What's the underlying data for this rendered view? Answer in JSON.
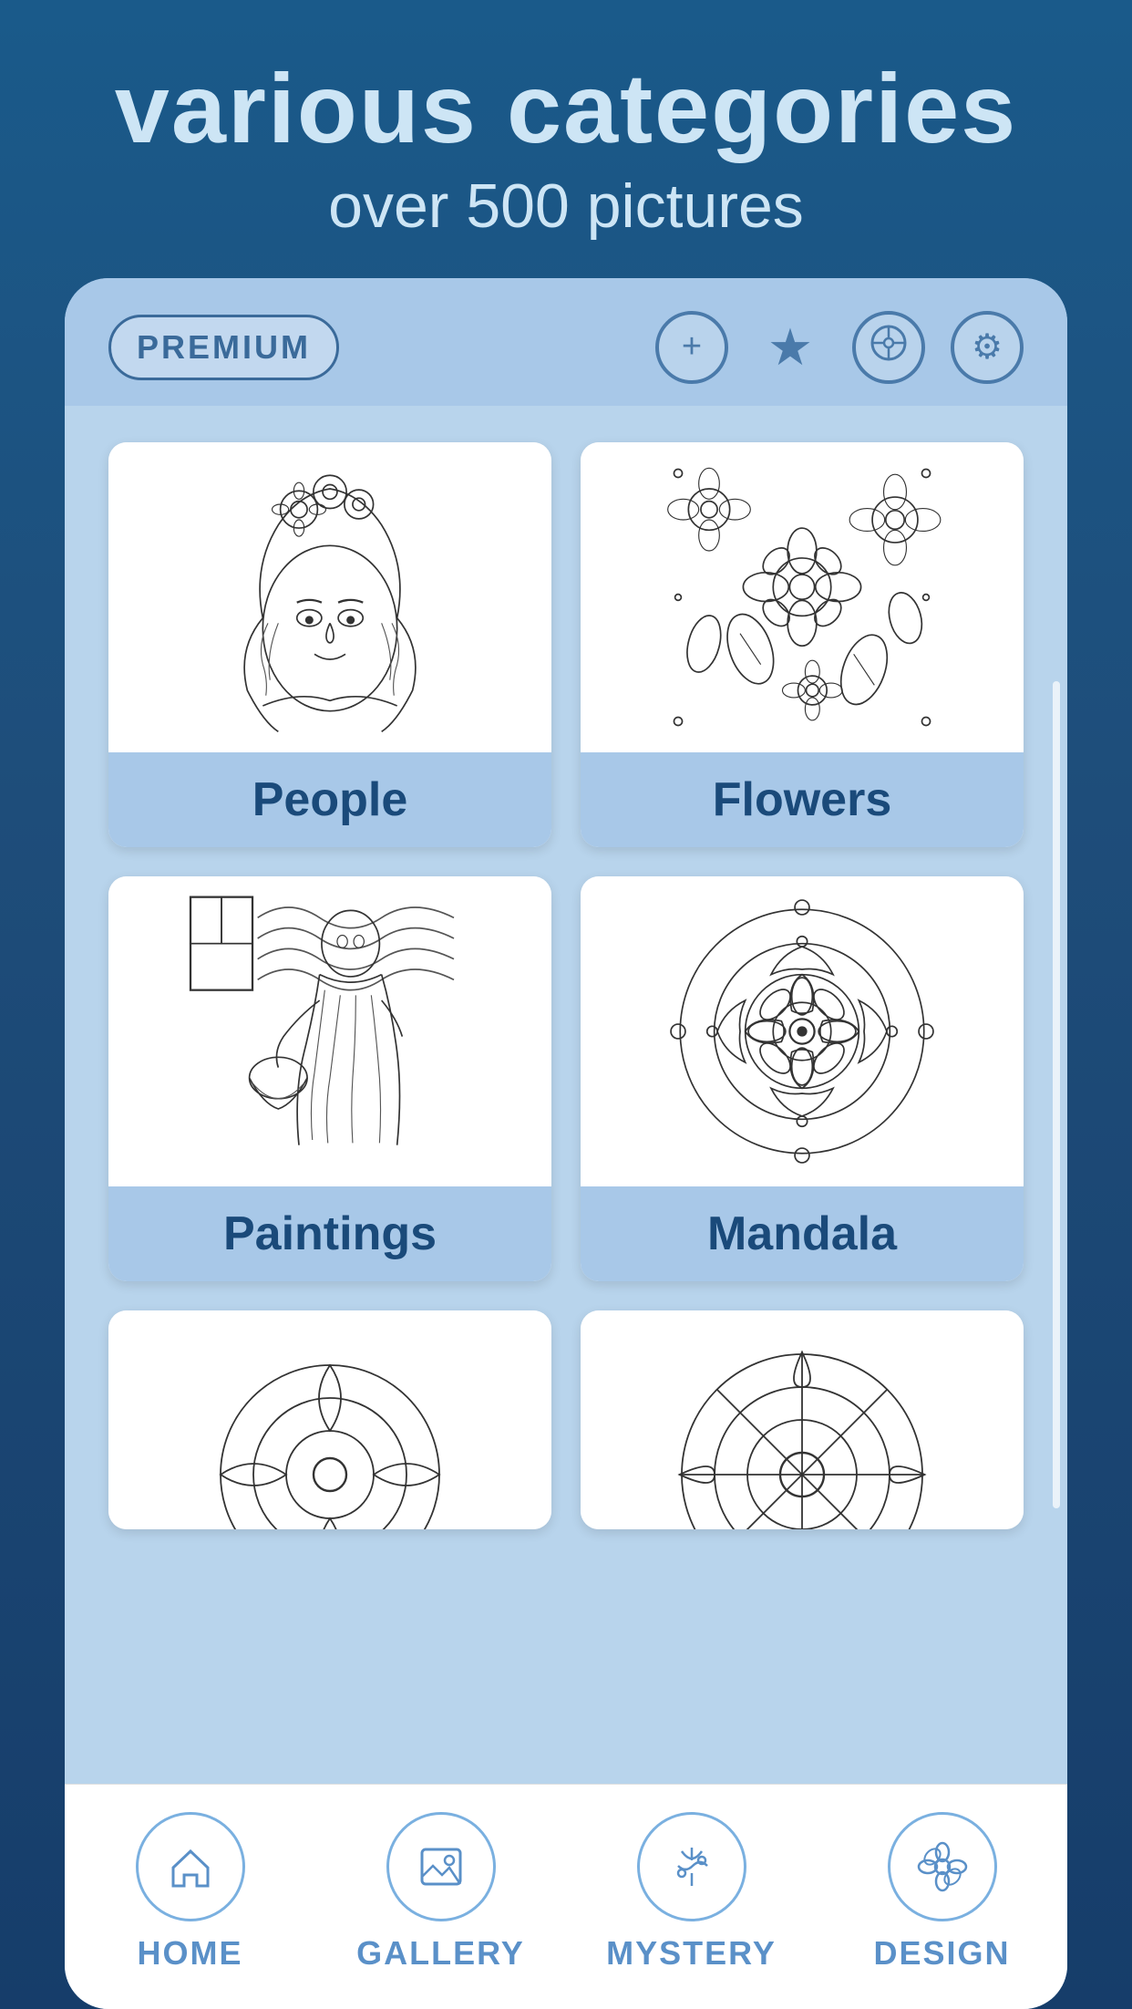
{
  "header": {
    "title": "various categories",
    "subtitle": "over 500 pictures"
  },
  "topbar": {
    "premium_label": "PREMIUM",
    "icons": [
      {
        "name": "add-icon",
        "symbol": "+"
      },
      {
        "name": "star-icon",
        "symbol": "★"
      },
      {
        "name": "share-icon",
        "symbol": "⊙"
      },
      {
        "name": "settings-icon",
        "symbol": "⚙"
      }
    ]
  },
  "categories": [
    {
      "id": "people",
      "label": "People"
    },
    {
      "id": "flowers",
      "label": "Flowers"
    },
    {
      "id": "paintings",
      "label": "Paintings"
    },
    {
      "id": "mandala",
      "label": "Mandala"
    },
    {
      "id": "partial1",
      "label": ""
    },
    {
      "id": "partial2",
      "label": ""
    }
  ],
  "bottom_nav": [
    {
      "id": "home",
      "label": "HOME",
      "icon": "house"
    },
    {
      "id": "gallery",
      "label": "GALLERY",
      "icon": "image"
    },
    {
      "id": "mystery",
      "label": "MYSTERY",
      "icon": "magic"
    },
    {
      "id": "design",
      "label": "DESIGN",
      "icon": "flower"
    }
  ]
}
